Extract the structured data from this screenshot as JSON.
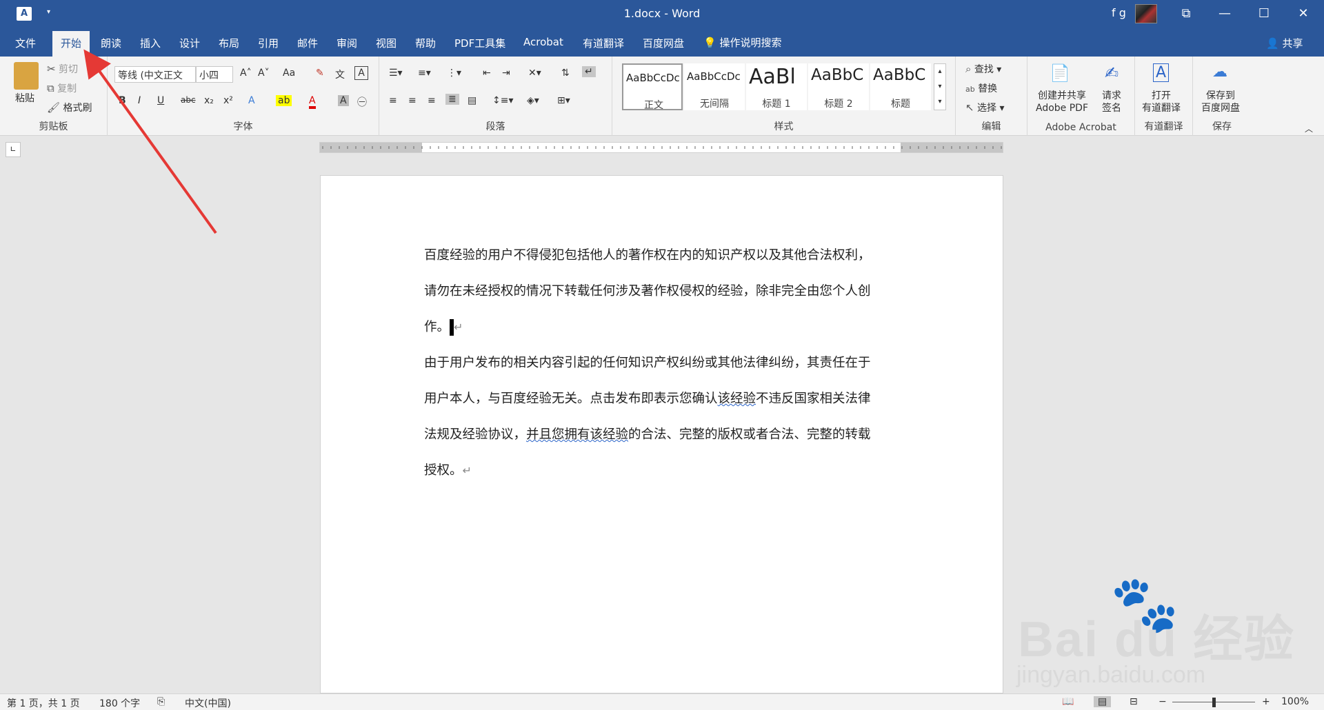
{
  "titlebar": {
    "app_icon": "A",
    "title": "1.docx - Word",
    "user": "f g",
    "restore_glyph": "⧉",
    "minimize_glyph": "—",
    "maximize_glyph": "☐",
    "close_glyph": "✕"
  },
  "tabs": [
    {
      "label": "文件"
    },
    {
      "label": "开始"
    },
    {
      "label": "朗读"
    },
    {
      "label": "插入"
    },
    {
      "label": "设计"
    },
    {
      "label": "布局"
    },
    {
      "label": "引用"
    },
    {
      "label": "邮件"
    },
    {
      "label": "审阅"
    },
    {
      "label": "视图"
    },
    {
      "label": "帮助"
    },
    {
      "label": "PDF工具集"
    },
    {
      "label": "Acrobat"
    },
    {
      "label": "有道翻译"
    },
    {
      "label": "百度网盘"
    }
  ],
  "tell_me": "操作说明搜索",
  "share": "共享",
  "clipboard": {
    "paste": "粘贴",
    "cut": "剪切",
    "copy": "复制",
    "format_painter": "格式刷",
    "label": "剪贴板"
  },
  "font": {
    "name": "等线 (中文正文",
    "size": "小四",
    "label": "字体",
    "bold": "B",
    "italic": "I",
    "underline": "U",
    "strike": "abc",
    "sub": "x₂",
    "sup": "x²",
    "case": "Aa"
  },
  "paragraph": {
    "label": "段落"
  },
  "styles": {
    "label": "样式",
    "items": [
      {
        "preview": "AaBbCcDc",
        "name": "正文"
      },
      {
        "preview": "AaBbCcDc",
        "name": "无间隔"
      },
      {
        "preview": "AaBl",
        "name": "标题 1"
      },
      {
        "preview": "AaBbC",
        "name": "标题 2"
      },
      {
        "preview": "AaBbC",
        "name": "标题"
      }
    ]
  },
  "editing": {
    "find": "查找",
    "replace": "替换",
    "select": "选择",
    "label": "编辑"
  },
  "acrobat": {
    "create_share_1": "创建并共享",
    "create_share_2": "Adobe PDF",
    "request_sign_1": "请求",
    "request_sign_2": "签名",
    "label": "Adobe Acrobat"
  },
  "youdao": {
    "open_1": "打开",
    "open_2": "有道翻译",
    "label": "有道翻译"
  },
  "baidu": {
    "save_1": "保存到",
    "save_2": "百度网盘",
    "label": "保存"
  },
  "document": {
    "p1_line1": "百度经验的用户不得侵犯包括他人的著作权在内的知识产权以及其他合法权利，",
    "p1_line2": "请勿在未经授权的情况下转载任何涉及著作权侵权的经验，除非完全由您个人创",
    "p1_line3": "作。",
    "p2_line1": "由于用户发布的相关内容引起的任何知识产权纠纷或其他法律纠纷，其责任在于",
    "p2_line2_a": "用户本人，与百度经验无关。点击发布即表示您确认",
    "p2_line2_b": "该经验",
    "p2_line2_c": "不违反国家相关法律",
    "p2_line3_a": "法规及经验协议，",
    "p2_line3_b": "并且您拥有该经验",
    "p2_line3_c": "的合法、完整的版权或者合法、完整的转载",
    "p2_line4": "授权。"
  },
  "statusbar": {
    "page": "第 1 页，共 1 页",
    "words": "180 个字",
    "language": "中文(中国)",
    "zoom": "100%"
  },
  "watermark": {
    "brand": "Bai du 经验",
    "url": "jingyan.baidu.com"
  },
  "colors": {
    "brand_blue": "#2b579a",
    "arrow_red": "#e53935"
  }
}
